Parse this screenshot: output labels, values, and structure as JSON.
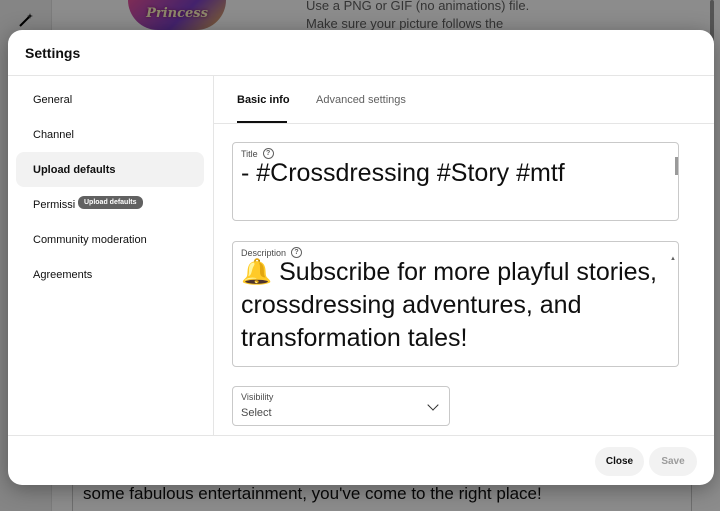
{
  "background": {
    "thumbnail_text": "Princess",
    "hint_line1": "Use a PNG or GIF (no animations) file.",
    "hint_line2": "Make sure your picture follows the",
    "description_snippet": "some fabulous entertainment, you've come to the right place!"
  },
  "dialog": {
    "title": "Settings",
    "sidebar": {
      "items": [
        {
          "label": "General"
        },
        {
          "label": "Channel"
        },
        {
          "label": "Upload defaults"
        },
        {
          "label": "Permissi"
        },
        {
          "label": "Community moderation"
        },
        {
          "label": "Agreements"
        }
      ],
      "active_index": 2,
      "tooltip": "Upload defaults"
    },
    "tabs": [
      {
        "label": "Basic info"
      },
      {
        "label": "Advanced settings"
      }
    ],
    "title_field": {
      "label": "Title",
      "value": "- #Crossdressing #Story #mtf"
    },
    "description_field": {
      "label": "Description",
      "value": "🔔 Subscribe for more playful stories, crossdressing adventures, and transformation tales!"
    },
    "visibility_field": {
      "label": "Visibility",
      "value": "Select"
    },
    "footer": {
      "close_label": "Close",
      "save_label": "Save"
    }
  }
}
